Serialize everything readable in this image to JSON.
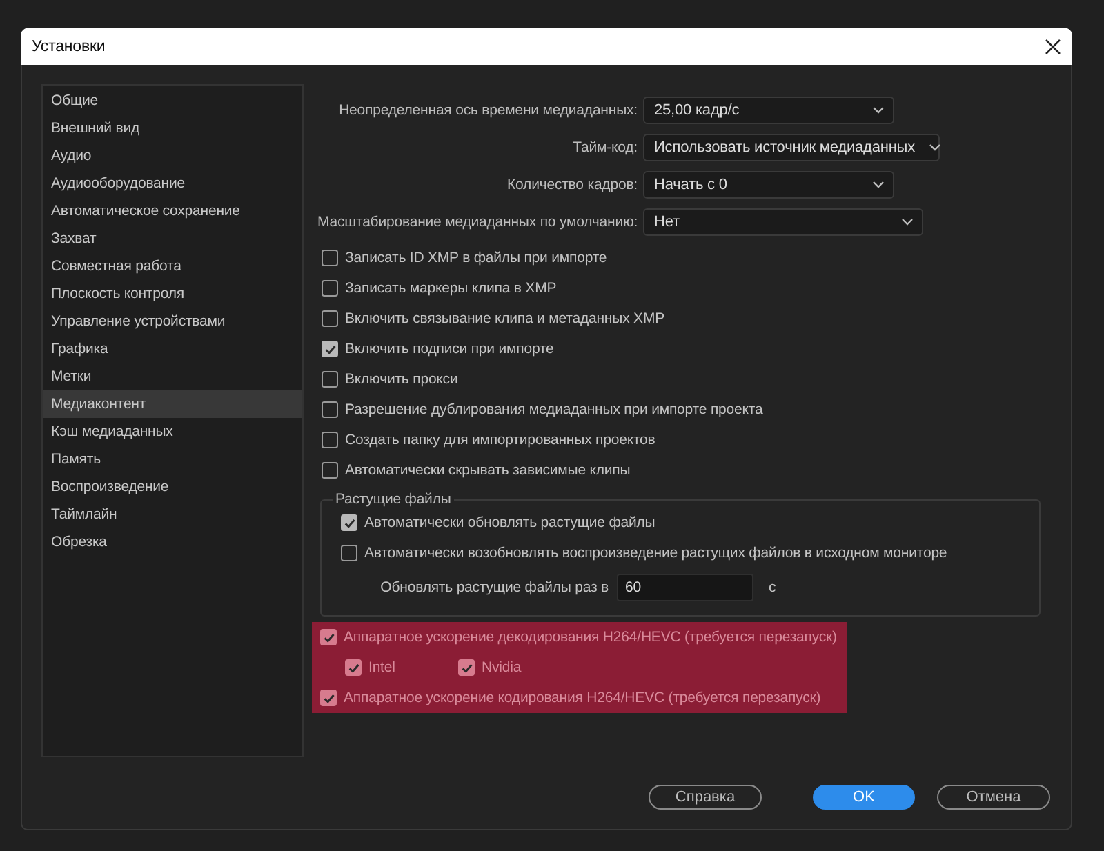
{
  "window": {
    "title": "Установки"
  },
  "sidebar": {
    "items": [
      {
        "label": "Общие",
        "selected": false
      },
      {
        "label": "Внешний вид",
        "selected": false
      },
      {
        "label": "Аудио",
        "selected": false
      },
      {
        "label": "Аудиооборудование",
        "selected": false
      },
      {
        "label": "Автоматическое сохранение",
        "selected": false
      },
      {
        "label": "Захват",
        "selected": false
      },
      {
        "label": "Совместная работа",
        "selected": false
      },
      {
        "label": "Плоскость контроля",
        "selected": false
      },
      {
        "label": "Управление устройствами",
        "selected": false
      },
      {
        "label": "Графика",
        "selected": false
      },
      {
        "label": "Метки",
        "selected": false
      },
      {
        "label": "Медиаконтент",
        "selected": true
      },
      {
        "label": "Кэш медиаданных",
        "selected": false
      },
      {
        "label": "Память",
        "selected": false
      },
      {
        "label": "Воспроизведение",
        "selected": false
      },
      {
        "label": "Таймлайн",
        "selected": false
      },
      {
        "label": "Обрезка",
        "selected": false
      }
    ]
  },
  "dropdowns": [
    {
      "label": "Неопределенная ось времени медиаданных:",
      "value": "25,00 кадр/с"
    },
    {
      "label": "Тайм-код:",
      "value": "Использовать источник медиаданных"
    },
    {
      "label": "Количество кадров:",
      "value": "Начать с 0"
    },
    {
      "label": "Масштабирование медиаданных по умолчанию:",
      "value": "Нет"
    }
  ],
  "checkboxes": [
    {
      "label": "Записать ID XMP в файлы при импорте",
      "checked": false
    },
    {
      "label": "Записать маркеры клипа в XMP",
      "checked": false
    },
    {
      "label": "Включить связывание клипа и метаданных XMP",
      "checked": false
    },
    {
      "label": "Включить подписи при импорте",
      "checked": true
    },
    {
      "label": "Включить прокси",
      "checked": false
    },
    {
      "label": "Разрешение дублирования медиаданных при импорте проекта",
      "checked": false
    },
    {
      "label": "Создать папку для импортированных проектов",
      "checked": false
    },
    {
      "label": "Автоматически скрывать зависимые клипы",
      "checked": false
    }
  ],
  "growing_files": {
    "title": "Растущие файлы",
    "checkboxes": [
      {
        "label": "Автоматически обновлять растущие файлы",
        "checked": true
      },
      {
        "label": "Автоматически возобновлять воспроизведение растущих файлов в исходном мониторе",
        "checked": false
      }
    ],
    "interval": {
      "label": "Обновлять растущие файлы раз в",
      "value": "60",
      "unit": "с"
    }
  },
  "hardware_acceleration": {
    "highlighted": true,
    "decode": {
      "label": "Аппаратное ускорение декодирования H264/HEVC (требуется перезапуск)",
      "checked": true
    },
    "decoders": [
      {
        "label": "Intel",
        "checked": true
      },
      {
        "label": "Nvidia",
        "checked": true
      }
    ],
    "encode": {
      "label": "Аппаратное ускорение кодирования H264/HEVC (требуется перезапуск)",
      "checked": true
    }
  },
  "buttons": [
    {
      "label": "Справка",
      "kind": "secondary"
    },
    {
      "label": "OK",
      "kind": "primary"
    },
    {
      "label": "Отмена",
      "kind": "secondary"
    }
  ]
}
